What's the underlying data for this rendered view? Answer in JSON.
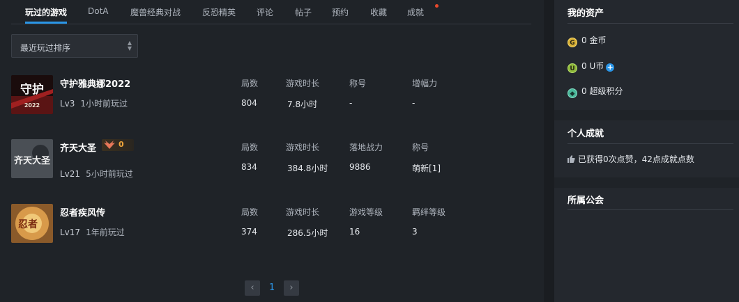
{
  "tabs": [
    {
      "label": "玩过的游戏"
    },
    {
      "label": "DotA"
    },
    {
      "label": "魔兽经典对战"
    },
    {
      "label": "反恐精英"
    },
    {
      "label": "评论"
    },
    {
      "label": "帖子"
    },
    {
      "label": "预约"
    },
    {
      "label": "收藏"
    },
    {
      "label": "成就"
    }
  ],
  "sort": {
    "selected": "最近玩过排序"
  },
  "games": [
    {
      "name": "守护雅典娜2022",
      "level": "Lv3",
      "last_played": "1小时前玩过",
      "thumb_text": "守护",
      "columns": [
        {
          "header": "局数",
          "value": "804"
        },
        {
          "header": "游戏时长",
          "value": "7.8小时"
        },
        {
          "header": "称号",
          "value": "-"
        },
        {
          "header": "增幅力",
          "value": "-"
        }
      ]
    },
    {
      "name": "齐天大圣",
      "badge_count": "0",
      "level": "Lv21",
      "last_played": "5小时前玩过",
      "thumb_text": "齐天大圣",
      "columns": [
        {
          "header": "局数",
          "value": "834"
        },
        {
          "header": "游戏时长",
          "value": "384.8小时"
        },
        {
          "header": "落地战力",
          "value": "9886"
        },
        {
          "header": "称号",
          "value": "萌新[1]"
        }
      ]
    },
    {
      "name": "忍者疾风传",
      "level": "Lv17",
      "last_played": "1年前玩过",
      "thumb_text": "忍者",
      "columns": [
        {
          "header": "局数",
          "value": "374"
        },
        {
          "header": "游戏时长",
          "value": "286.5小时"
        },
        {
          "header": "游戏等级",
          "value": "16"
        },
        {
          "header": "羁绊等级",
          "value": "3"
        }
      ]
    }
  ],
  "pager": {
    "prev": "‹",
    "current": "1",
    "next": "›"
  },
  "assets": {
    "title": "我的资产",
    "gold": {
      "icon_letter": "G",
      "text": "0 金币"
    },
    "ucoin": {
      "icon_letter": "U",
      "text": "0 U币"
    },
    "super": {
      "icon_letter": "◆",
      "text": "0 超级积分"
    }
  },
  "achievements": {
    "title": "个人成就",
    "text": "已获得0次点赞，42点成就点数"
  },
  "guild": {
    "title": "所属公会"
  },
  "colors": {
    "accent": "#2a96e8",
    "badge": "#f0a53a",
    "notification": "#e8482c"
  }
}
